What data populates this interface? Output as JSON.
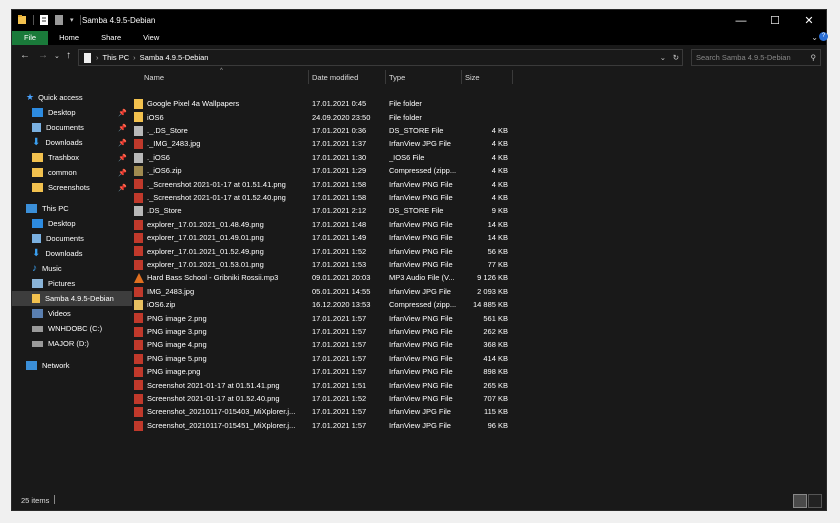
{
  "window": {
    "title": "Samba 4.9.5-Debian",
    "controls": {
      "minimize": "—",
      "maximize": "☐",
      "close": "✕"
    }
  },
  "ribbon": {
    "tabs": [
      "File",
      "Home",
      "Share",
      "View"
    ],
    "expand": "⌄"
  },
  "address": {
    "crumbs": [
      "This PC",
      "Samba 4.9.5-Debian"
    ],
    "search_placeholder": "Search Samba 4.9.5-Debian"
  },
  "nav": {
    "quick_access": "Quick access",
    "quick_items": [
      "Desktop",
      "Documents",
      "Downloads",
      "Trashbox",
      "common",
      "Screenshots"
    ],
    "this_pc": "This PC",
    "pc_items": [
      "Desktop",
      "Documents",
      "Downloads",
      "Music",
      "Pictures",
      "Samba 4.9.5-Debian",
      "Videos",
      "WNHDOBC (C:)",
      "MAJOR (D:)"
    ],
    "network": "Network"
  },
  "columns": {
    "name": "Name",
    "date": "Date modified",
    "type": "Type",
    "size": "Size"
  },
  "files": [
    {
      "name": "Google Pixel 4a Wallpapers",
      "date": "17.01.2021 0:45",
      "type": "File folder",
      "size": "",
      "icon": "folder"
    },
    {
      "name": "iOS6",
      "date": "24.09.2020 23:50",
      "type": "File folder",
      "size": "",
      "icon": "folder"
    },
    {
      "name": "._.DS_Store",
      "date": "17.01.2021 0:36",
      "type": "DS_STORE File",
      "size": "4 KB",
      "icon": "file"
    },
    {
      "name": "._IMG_2483.jpg",
      "date": "17.01.2021 1:37",
      "type": "IrfanView JPG File",
      "size": "4 KB",
      "icon": "image"
    },
    {
      "name": "._iOS6",
      "date": "17.01.2021 1:30",
      "type": "_IOS6 File",
      "size": "4 KB",
      "icon": "file"
    },
    {
      "name": "._iOS6.zip",
      "date": "17.01.2021 1:29",
      "type": "Compressed (zipp...",
      "size": "4 KB",
      "icon": "zip"
    },
    {
      "name": "._Screenshot 2021-01-17 at 01.51.41.png",
      "date": "17.01.2021 1:58",
      "type": "IrfanView PNG File",
      "size": "4 KB",
      "icon": "image"
    },
    {
      "name": "._Screenshot 2021-01-17 at 01.52.40.png",
      "date": "17.01.2021 1:58",
      "type": "IrfanView PNG File",
      "size": "4 KB",
      "icon": "image"
    },
    {
      "name": ".DS_Store",
      "date": "17.01.2021 2:12",
      "type": "DS_STORE File",
      "size": "9 KB",
      "icon": "file"
    },
    {
      "name": "explorer_17.01.2021_01.48.49.png",
      "date": "17.01.2021 1:48",
      "type": "IrfanView PNG File",
      "size": "14 KB",
      "icon": "image"
    },
    {
      "name": "explorer_17.01.2021_01.49.01.png",
      "date": "17.01.2021 1:49",
      "type": "IrfanView PNG File",
      "size": "14 KB",
      "icon": "image"
    },
    {
      "name": "explorer_17.01.2021_01.52.49.png",
      "date": "17.01.2021 1:52",
      "type": "IrfanView PNG File",
      "size": "56 KB",
      "icon": "image"
    },
    {
      "name": "explorer_17.01.2021_01.53.01.png",
      "date": "17.01.2021 1:53",
      "type": "IrfanView PNG File",
      "size": "77 KB",
      "icon": "image"
    },
    {
      "name": "Hard Bass School - Gribniki Rossii.mp3",
      "date": "09.01.2021 20:03",
      "type": "MP3 Audio File (V...",
      "size": "9 126 KB",
      "icon": "audio"
    },
    {
      "name": "IMG_2483.jpg",
      "date": "05.01.2021 14:55",
      "type": "IrfanView JPG File",
      "size": "2 093 KB",
      "icon": "image"
    },
    {
      "name": "iOS6.zip",
      "date": "16.12.2020 13:53",
      "type": "Compressed (zipp...",
      "size": "14 885 KB",
      "icon": "zipfolder"
    },
    {
      "name": "PNG image 2.png",
      "date": "17.01.2021 1:57",
      "type": "IrfanView PNG File",
      "size": "561 KB",
      "icon": "image"
    },
    {
      "name": "PNG image 3.png",
      "date": "17.01.2021 1:57",
      "type": "IrfanView PNG File",
      "size": "262 KB",
      "icon": "image"
    },
    {
      "name": "PNG image 4.png",
      "date": "17.01.2021 1:57",
      "type": "IrfanView PNG File",
      "size": "368 KB",
      "icon": "image"
    },
    {
      "name": "PNG image 5.png",
      "date": "17.01.2021 1:57",
      "type": "IrfanView PNG File",
      "size": "414 KB",
      "icon": "image"
    },
    {
      "name": "PNG image.png",
      "date": "17.01.2021 1:57",
      "type": "IrfanView PNG File",
      "size": "898 KB",
      "icon": "image"
    },
    {
      "name": "Screenshot 2021-01-17 at 01.51.41.png",
      "date": "17.01.2021 1:51",
      "type": "IrfanView PNG File",
      "size": "265 KB",
      "icon": "image"
    },
    {
      "name": "Screenshot 2021-01-17 at 01.52.40.png",
      "date": "17.01.2021 1:52",
      "type": "IrfanView PNG File",
      "size": "707 KB",
      "icon": "image"
    },
    {
      "name": "Screenshot_20210117-015403_MiXplorer.j...",
      "date": "17.01.2021 1:57",
      "type": "IrfanView JPG File",
      "size": "115 KB",
      "icon": "image"
    },
    {
      "name": "Screenshot_20210117-015451_MiXplorer.j...",
      "date": "17.01.2021 1:57",
      "type": "IrfanView JPG File",
      "size": "96 KB",
      "icon": "image"
    }
  ],
  "status": {
    "count": "25 items"
  },
  "colors": {
    "file_tab": "#1a7a3a",
    "background": "#191919",
    "selected": "#3d3d3d"
  }
}
